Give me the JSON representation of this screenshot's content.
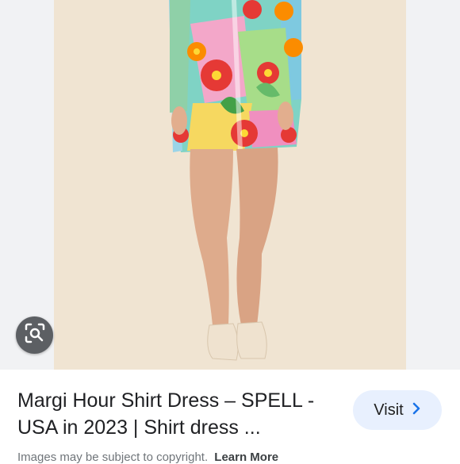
{
  "result": {
    "title": "Margi Hour Shirt Dress – SPELL - USA in 2023 | Shirt dress ...",
    "visit_label": "Visit",
    "visit_icon": "chevron-right-icon",
    "lens_icon": "lens-search-icon"
  },
  "footer": {
    "copyright_text": "Images may be subject to copyright.",
    "learn_more_label": "Learn More"
  },
  "colors": {
    "photo_background": "#f0e4d2",
    "visit_button_bg": "#e8f0fe",
    "accent_blue": "#1a73e8"
  }
}
